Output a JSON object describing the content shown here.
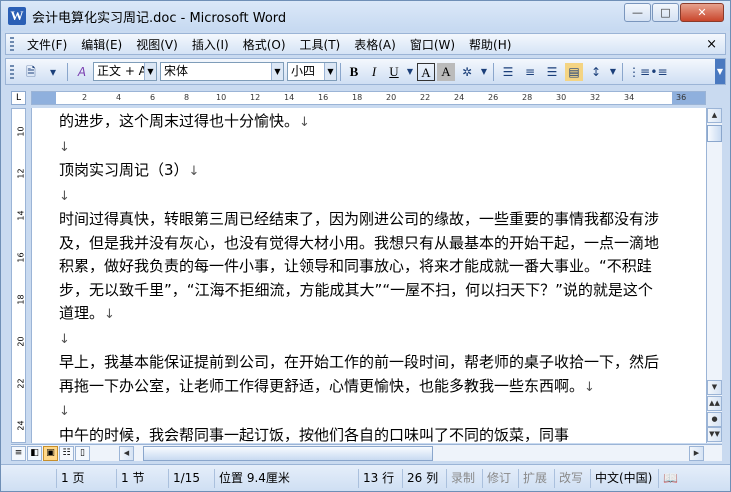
{
  "window": {
    "title": "会计电算化实习周记.doc - Microsoft Word",
    "app_icon": "W",
    "controls": [
      "—",
      "□",
      "✕"
    ]
  },
  "menu": {
    "items": [
      "文件(F)",
      "编辑(E)",
      "视图(V)",
      "插入(I)",
      "格式(O)",
      "工具(T)",
      "表格(A)",
      "窗口(W)",
      "帮助(H)"
    ],
    "close": "×"
  },
  "toolbar": {
    "style_value": "正文 + Aria",
    "font_value": "宋体",
    "size_value": "小四",
    "bold": "B",
    "italic": "I",
    "underline": "U",
    "char_border": "A",
    "char_shading": "A"
  },
  "ruler": {
    "corner": "L",
    "marks": [
      "2",
      "4",
      "6",
      "8",
      "10",
      "12",
      "14",
      "16",
      "18",
      "20",
      "22",
      "24",
      "26",
      "28",
      "30",
      "32",
      "34",
      "36"
    ],
    "vertical_marks": [
      "10",
      "12",
      "14",
      "16",
      "18",
      "20",
      "22",
      "24"
    ]
  },
  "document": {
    "paragraphs": [
      {
        "text": "的进步，这个周末过得也十分愉快。",
        "mark": "↓"
      },
      {
        "text": "",
        "mark": "↓"
      },
      {
        "text": "顶岗实习周记（3）",
        "mark": "↓"
      },
      {
        "text": "",
        "mark": "↓"
      },
      {
        "text": "时间过得真快，转眼第三周已经结束了，因为刚进公司的缘故，一些重要的事情我都没有涉及，但是我并没有灰心，也没有觉得大材小用。我想只有从最基本的开始干起，一点一滴地积累，做好我负责的每一件小事，让领导和同事放心，将来才能成就一番大事业。“不积跬步，无以致千里”，“江海不拒细流，方能成其大”“一屋不扫，何以扫天下？”说的就是这个道理。",
        "mark": "↓"
      },
      {
        "text": "",
        "mark": "↓"
      },
      {
        "text": "早上，我基本能保证提前到公司，在开始工作的前一段时间，帮老师的桌子收拾一下，然后再拖一下办公室，让老师工作得更舒适，心情更愉快，也能多教我一些东西啊。",
        "mark": "↓"
      },
      {
        "text": "",
        "mark": "↓"
      },
      {
        "text": "中午的时候，我会帮同事一起订饭，按他们各自的口味叫了不同的饭菜，同事",
        "mark": ""
      }
    ]
  },
  "status": {
    "page": "1 页",
    "section": "1 节",
    "pages": "1/15",
    "position": "位置 9.4厘米",
    "line": "13 行",
    "column": "26 列",
    "rec": "录制",
    "trk": "修订",
    "ext": "扩展",
    "ovr": "改写",
    "language": "中文(中国)"
  },
  "colors": {
    "title_bar": "#c6d9f1",
    "close_button": "#c9462c",
    "view_active": "#ffd88a"
  }
}
